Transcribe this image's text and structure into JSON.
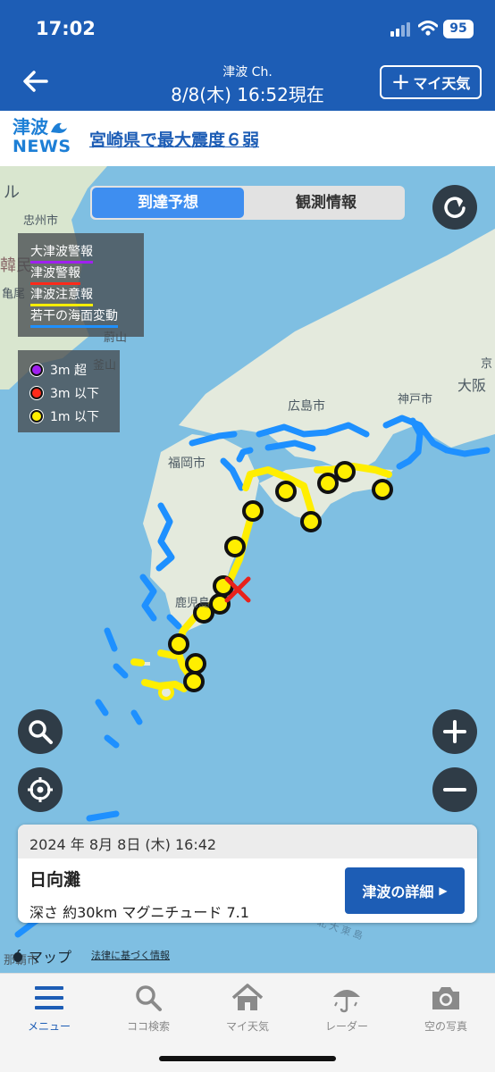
{
  "status_bar": {
    "time": "17:02",
    "battery": "95"
  },
  "nav": {
    "channel": "津波 Ch.",
    "datetime": "8/8(木) 16:52現在",
    "my_weather": "マイ天気"
  },
  "news": {
    "logo_top": "津波",
    "logo_bottom": "NEWS",
    "headline": "宮崎県で最大震度６弱"
  },
  "map": {
    "tabs": [
      {
        "label": "到達予想",
        "active": true
      },
      {
        "label": "観測情報",
        "active": false
      }
    ],
    "legend_warnings": [
      {
        "label": "大津波警報",
        "color": "#a020f0"
      },
      {
        "label": "津波警報",
        "color": "#ff2a1a"
      },
      {
        "label": "津波注意報",
        "color": "#ffee00"
      },
      {
        "label": "若干の海面変動",
        "color": "#1e90ff"
      }
    ],
    "legend_heights": [
      {
        "label": "3m 超",
        "color": "#a020f0"
      },
      {
        "label": "3m 以下",
        "color": "#ff2a1a"
      },
      {
        "label": "1m 以下",
        "color": "#ffee00"
      }
    ],
    "place_labels": [
      "ル",
      "忠州市",
      "韓民",
      "亀尾",
      "蔚山",
      "釜山",
      "広島市",
      "福岡市",
      "神戸市",
      "大阪",
      "京",
      "鹿児島",
      "那覇市"
    ],
    "sea_label": "北大東島",
    "epicenter_icon": "cross-mark-icon"
  },
  "quake": {
    "time": "2024 年 8月 8日 (木) 16:42",
    "location": "日向灘",
    "meta": "深さ 約30km マグニチュード 7.1",
    "detail_button": "津波の詳細"
  },
  "attribution": {
    "maps": "マップ",
    "law": "法律に基づく情報"
  },
  "bottom_nav": [
    {
      "label": "メニュー",
      "icon": "menu-icon",
      "active": true
    },
    {
      "label": "ココ検索",
      "icon": "search-icon",
      "active": false
    },
    {
      "label": "マイ天気",
      "icon": "home-icon",
      "active": false
    },
    {
      "label": "レーダー",
      "icon": "umbrella-icon",
      "active": false
    },
    {
      "label": "空の写真",
      "icon": "camera-icon",
      "active": false
    }
  ]
}
